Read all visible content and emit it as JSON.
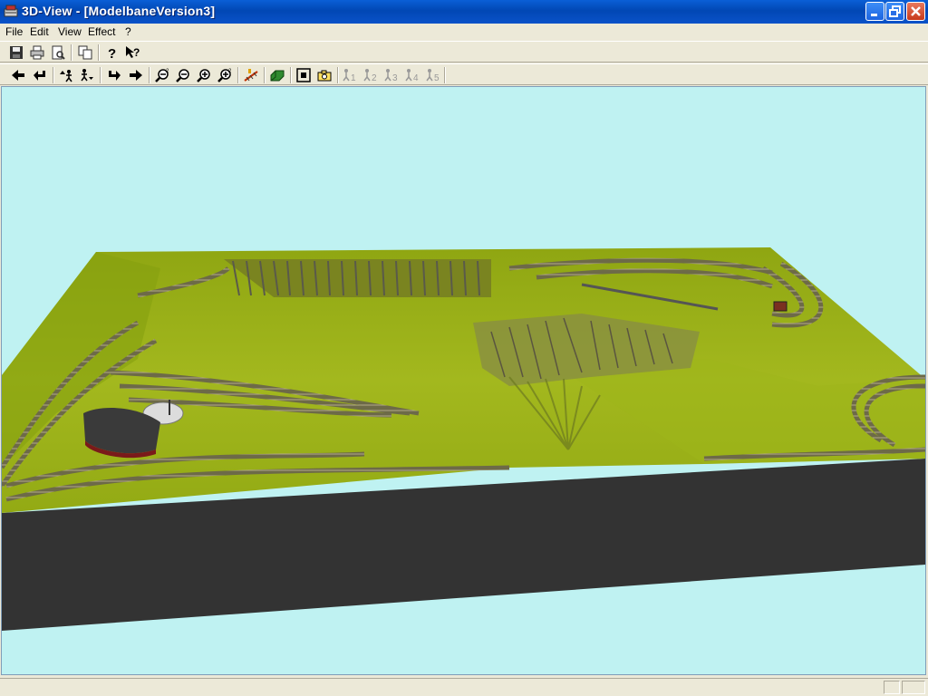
{
  "window": {
    "title": "3D-View - [ModelbaneVersion3]",
    "controls": [
      "minimize",
      "restore",
      "close"
    ]
  },
  "menu": {
    "items": [
      "File",
      "Edit",
      "View",
      "Effect",
      "?"
    ]
  },
  "toolbar_main": {
    "buttons": [
      {
        "name": "save-icon"
      },
      {
        "name": "print-icon"
      },
      {
        "name": "print-preview-icon"
      },
      {
        "name": "copy-icon"
      },
      {
        "name": "help-icon"
      },
      {
        "name": "context-help-icon"
      }
    ]
  },
  "toolbar_view": {
    "buttons": [
      {
        "name": "arrow-left-icon"
      },
      {
        "name": "undo-turn-icon"
      },
      {
        "name": "camera-up-icon"
      },
      {
        "name": "camera-mode-icon"
      },
      {
        "name": "redo-turn-icon"
      },
      {
        "name": "arrow-right-icon"
      },
      {
        "name": "zoom-out-large-icon"
      },
      {
        "name": "zoom-out-icon"
      },
      {
        "name": "zoom-in-icon"
      },
      {
        "name": "zoom-in-large-icon"
      },
      {
        "name": "track-icon"
      },
      {
        "name": "terrain-icon"
      },
      {
        "name": "fit-view-icon"
      },
      {
        "name": "camera-icon"
      }
    ],
    "viewpoints": [
      "1",
      "2",
      "3",
      "4",
      "5"
    ]
  },
  "viewport": {
    "sky_color": "#bff2f2",
    "terrain_color": "#9bb21a",
    "base_color": "#333333"
  },
  "statusbar": {
    "text": ""
  }
}
